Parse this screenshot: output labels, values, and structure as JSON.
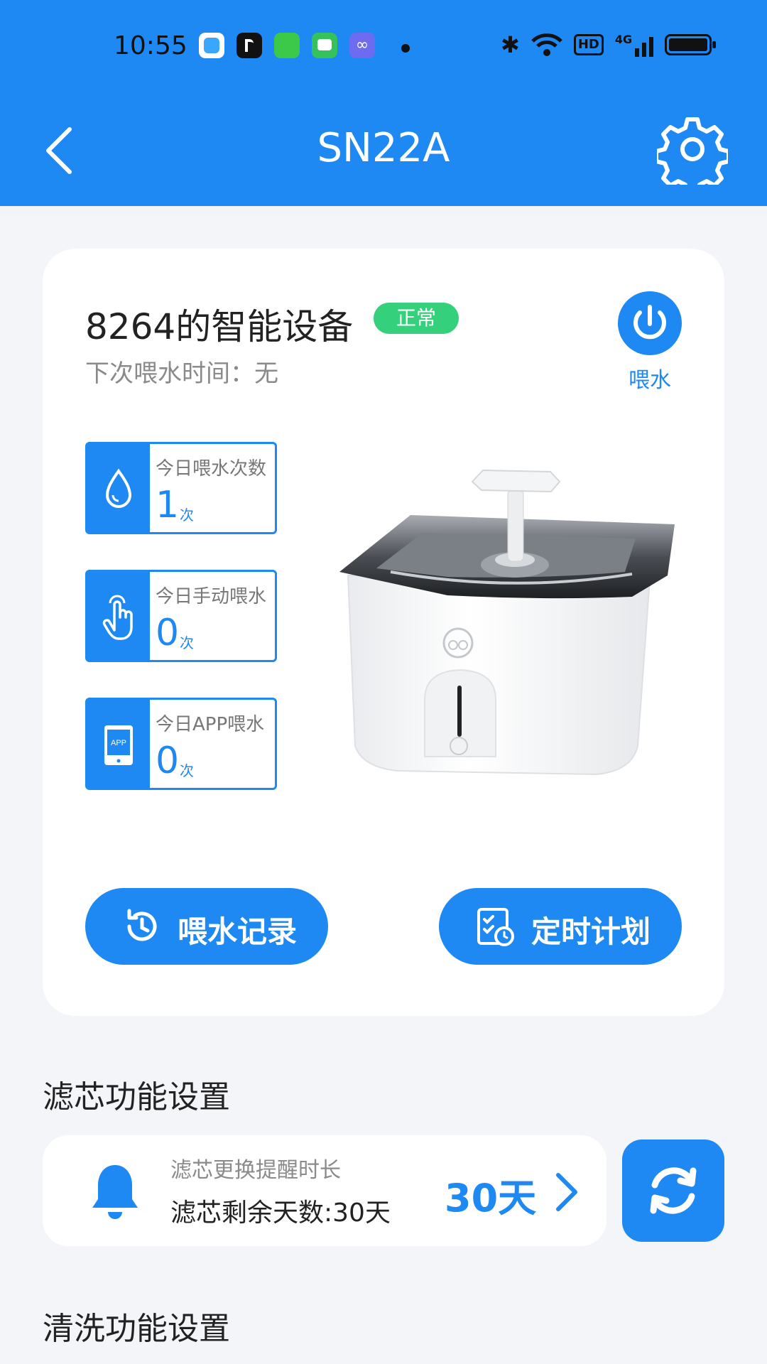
{
  "status_bar": {
    "time": "10:55",
    "hd": "HD",
    "network": "4G"
  },
  "header": {
    "title": "SN22A"
  },
  "device": {
    "name": "8264的智能设备",
    "status_badge": "正常",
    "next_time": "下次喂水时间：无",
    "power_label": "喂水"
  },
  "stats": [
    {
      "label": "今日喂水次数",
      "value": "1",
      "unit": "次",
      "icon": "water-drop-icon"
    },
    {
      "label": "今日手动喂水",
      "value": "0",
      "unit": "次",
      "icon": "hand-tap-icon"
    },
    {
      "label": "今日APP喂水",
      "value": "0",
      "unit": "次",
      "icon": "phone-app-icon"
    }
  ],
  "app_icon_text": "APP",
  "actions": {
    "record": "喂水记录",
    "schedule": "定时计划"
  },
  "filter": {
    "section_title": "滤芯功能设置",
    "label": "滤芯更换提醒时长",
    "remaining": "滤芯剩余天数:30天",
    "days": "30天"
  },
  "clean": {
    "section_title": "清洗功能设置"
  },
  "colors": {
    "primary": "#1e88f3",
    "badge": "#34d07b",
    "background": "#f3f5f9"
  }
}
